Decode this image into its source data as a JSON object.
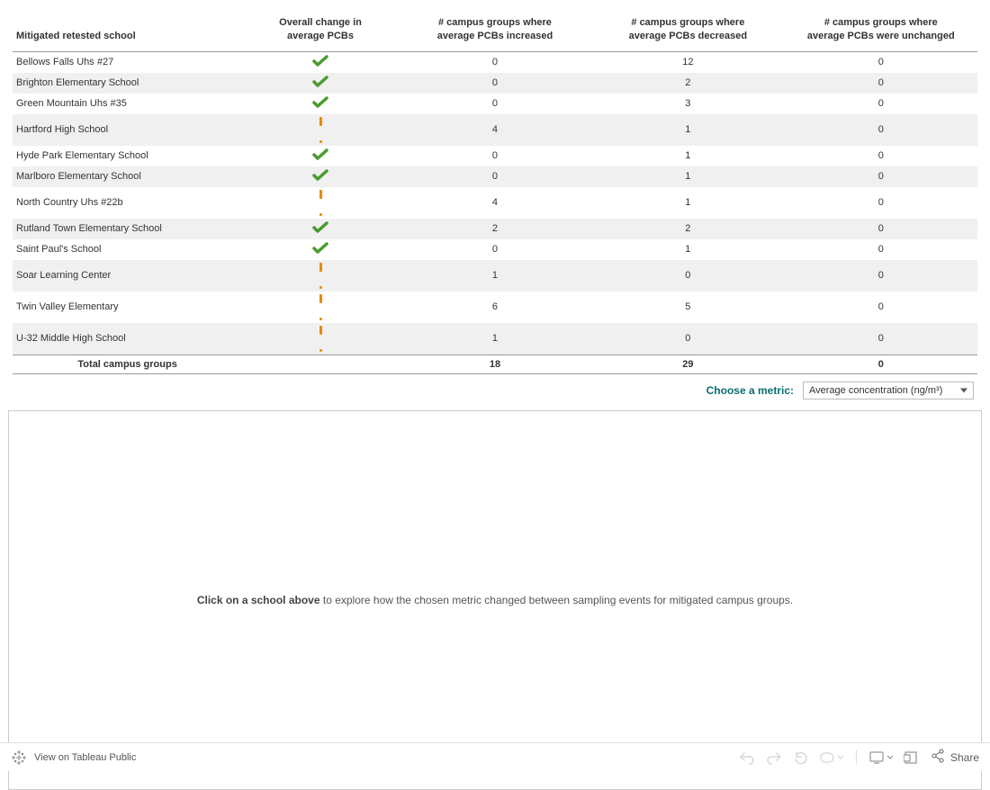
{
  "table": {
    "headers": {
      "school": "Mitigated retested school",
      "overall_l1": "Overall change in",
      "overall_l2": "average PCBs",
      "incr_l1": "# campus groups where",
      "incr_l2": "average PCBs increased",
      "decr_l1": "# campus groups where",
      "decr_l2": "average PCBs decreased",
      "unch_l1": "# campus groups where",
      "unch_l2": "average PCBs were unchanged"
    },
    "rows": [
      {
        "school": "Bellows Falls Uhs #27",
        "status": "check",
        "incr": "0",
        "decr": "12",
        "unch": "0"
      },
      {
        "school": "Brighton Elementary School",
        "status": "check",
        "incr": "0",
        "decr": "2",
        "unch": "0"
      },
      {
        "school": "Green Mountain Uhs #35",
        "status": "check",
        "incr": "0",
        "decr": "3",
        "unch": "0"
      },
      {
        "school": "Hartford High School",
        "status": "excl",
        "incr": "4",
        "decr": "1",
        "unch": "0"
      },
      {
        "school": "Hyde Park Elementary School",
        "status": "check",
        "incr": "0",
        "decr": "1",
        "unch": "0"
      },
      {
        "school": "Marlboro Elementary School",
        "status": "check",
        "incr": "0",
        "decr": "1",
        "unch": "0"
      },
      {
        "school": "North Country Uhs #22b",
        "status": "excl",
        "incr": "4",
        "decr": "1",
        "unch": "0"
      },
      {
        "school": "Rutland Town Elementary School",
        "status": "check",
        "incr": "2",
        "decr": "2",
        "unch": "0"
      },
      {
        "school": "Saint Paul's School",
        "status": "check",
        "incr": "0",
        "decr": "1",
        "unch": "0"
      },
      {
        "school": "Soar Learning Center",
        "status": "excl",
        "incr": "1",
        "decr": "0",
        "unch": "0"
      },
      {
        "school": "Twin Valley Elementary",
        "status": "excl",
        "incr": "6",
        "decr": "5",
        "unch": "0"
      },
      {
        "school": "U-32 Middle High School",
        "status": "excl",
        "incr": "1",
        "decr": "0",
        "unch": "0"
      }
    ],
    "total": {
      "label": "Total campus groups",
      "incr": "18",
      "decr": "29",
      "unch": "0"
    }
  },
  "controls": {
    "metric_label": "Choose a metric:",
    "metric_value": "Average concentration (ng/m³)"
  },
  "viz": {
    "prompt_bold": "Click on a school above",
    "prompt_rest": " to explore how the chosen metric changed between sampling events for mitigated campus groups."
  },
  "footer": {
    "logo_text": "View on Tableau Public",
    "share": "Share"
  }
}
